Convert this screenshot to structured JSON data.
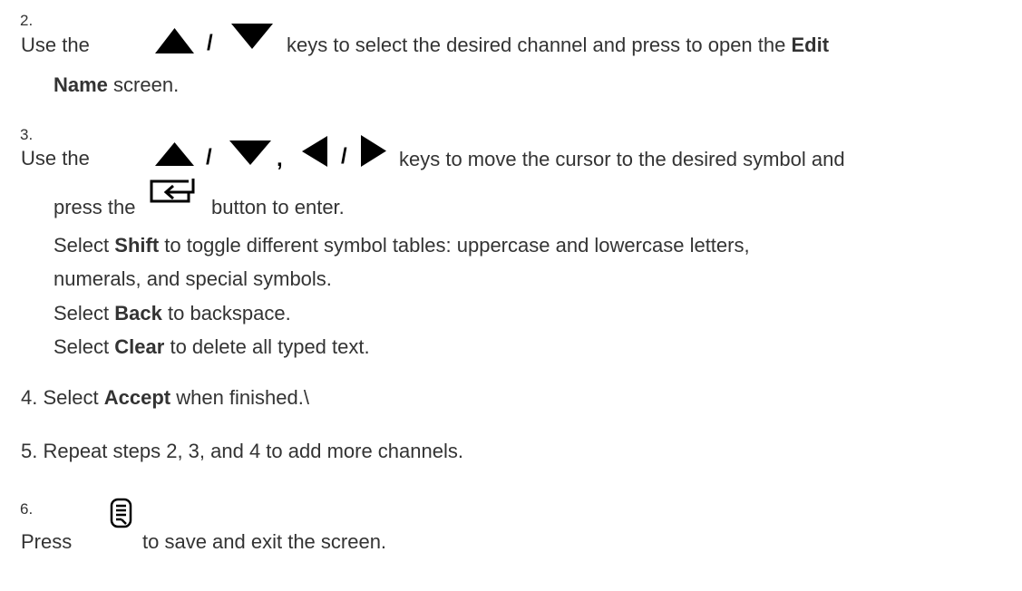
{
  "step2": {
    "number": "2.",
    "pre": "Use the",
    "sep": "/",
    "mid": "keys to select the desired channel and press to open the",
    "edit": "Edit",
    "name": "Name",
    "screen": "screen.",
    "icons": [
      "up-arrow",
      "down-arrow"
    ]
  },
  "step3": {
    "number": "3.",
    "pre": "Use the",
    "sep1": "/",
    "comma": ",",
    "sep2": "/",
    "mid": "keys to move the cursor to the desired symbol and",
    "press": "press the",
    "enter_text": "button to enter.",
    "shift_pre": "Select",
    "shift": "Shift",
    "shift_post": "to toggle different symbol tables: uppercase and lowercase letters,",
    "shift_line2": "numerals, and special symbols.",
    "back_pre": "Select",
    "back": "Back",
    "back_post": "to backspace.",
    "clear_pre": "Select",
    "clear": "Clear",
    "clear_post": "to delete all typed text.",
    "icons": [
      "up-arrow",
      "down-arrow",
      "left-arrow",
      "right-arrow",
      "enter-key"
    ]
  },
  "step4": {
    "pre": "4. Select",
    "accept": "Accept",
    "post": "when finished.\\"
  },
  "step5": {
    "text": "5. Repeat steps 2, 3, and 4 to add more channels."
  },
  "step6": {
    "number": "6.",
    "pre": "Press",
    "post": "to save and exit the screen.",
    "icon": "menu-key"
  }
}
